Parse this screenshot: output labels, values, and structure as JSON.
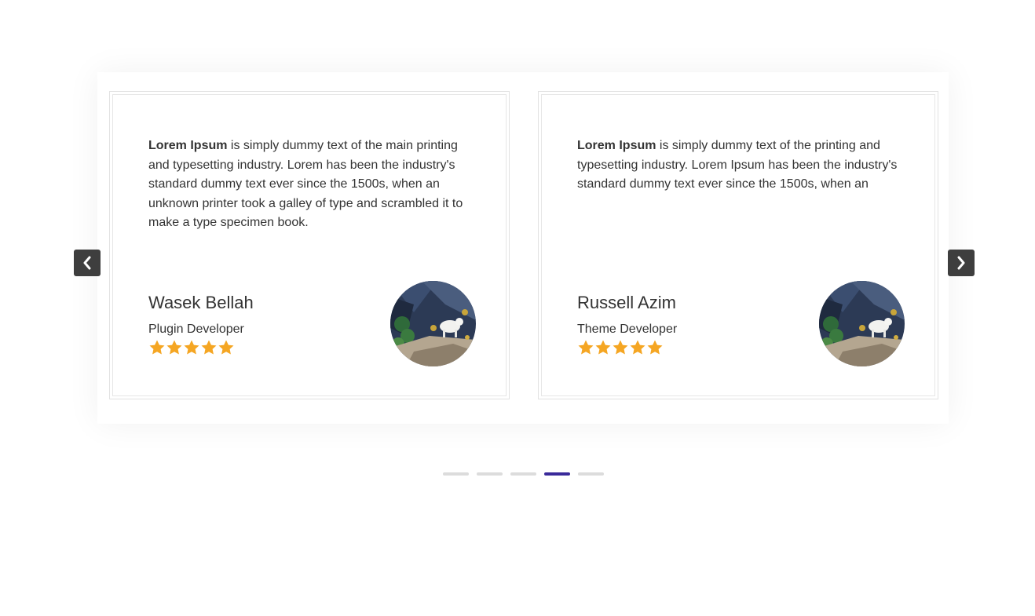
{
  "colors": {
    "accent": "#3a2a9a",
    "dot_inactive": "#dcdcdc",
    "star": "#f5a623",
    "nav_bg": "#3e3e3e",
    "text": "#333333"
  },
  "navigation": {
    "prev_icon": "chevron-left-icon",
    "next_icon": "chevron-right-icon"
  },
  "testimonials": [
    {
      "quote_bold": "Lorem Ipsum",
      "quote_rest": " is simply dummy text of the main printing and typesetting industry. Lorem has been the industry's standard dummy text ever since the 1500s, when an unknown printer took a galley of type and scrambled it to make a type specimen book.",
      "name": "Wasek Bellah",
      "role": "Plugin Developer",
      "rating": 5,
      "rating_max": 5
    },
    {
      "quote_bold": "Lorem Ipsum",
      "quote_rest": " is simply dummy text of the printing and typesetting industry. Lorem Ipsum has been the industry's standard dummy text ever since the 1500s, when an",
      "name": "Russell Azim",
      "role": "Theme Developer",
      "rating": 5,
      "rating_max": 5
    }
  ],
  "pagination": {
    "total": 5,
    "active_index": 3
  }
}
